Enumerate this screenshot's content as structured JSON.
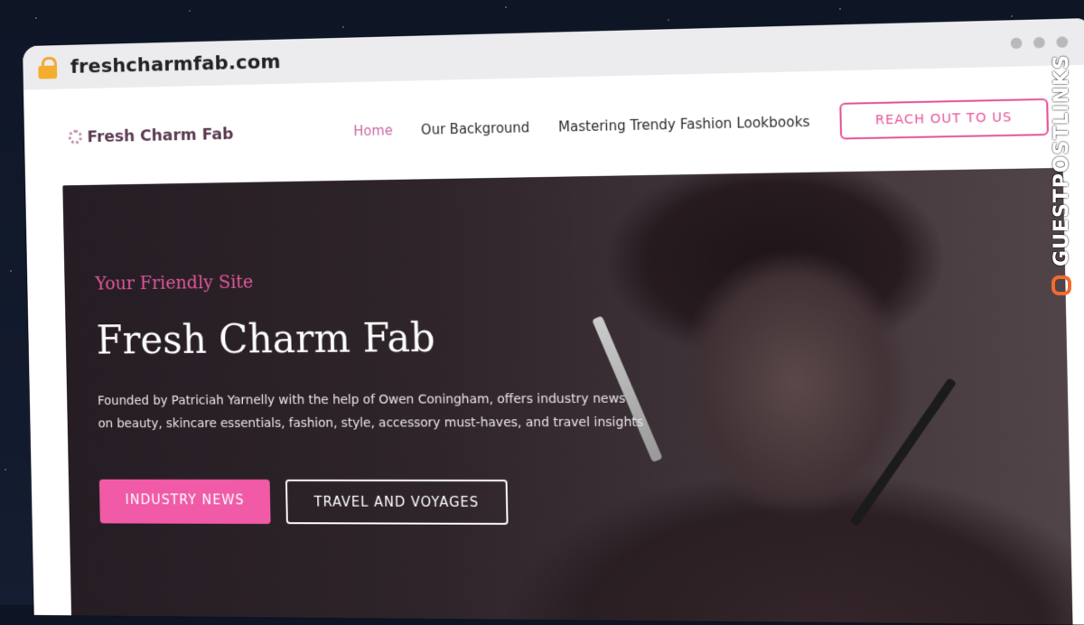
{
  "browser": {
    "url": "freshcharmfab.com"
  },
  "nav": {
    "logo": "Fresh Charm Fab",
    "items": [
      {
        "label": "Home",
        "active": true
      },
      {
        "label": "Our Background",
        "active": false
      },
      {
        "label": "Mastering Trendy Fashion Lookbooks",
        "active": false
      }
    ],
    "cta": "REACH OUT TO US"
  },
  "hero": {
    "tagline": "Your Friendly Site",
    "title": "Fresh Charm Fab",
    "description": "Founded by Patriciah Yarnelly with the help of Owen Coningham, offers industry news on beauty, skincare essentials, fashion, style, accessory must-haves, and travel insights",
    "buttons": {
      "primary": "INDUSTRY NEWS",
      "secondary": "TRAVEL AND VOYAGES"
    }
  },
  "watermark": {
    "text": "GUESTPOSTLINKS"
  },
  "colors": {
    "accent": "#f05aa6",
    "brand_text": "#5b3b52",
    "watermark_icon": "#f26a2c"
  }
}
